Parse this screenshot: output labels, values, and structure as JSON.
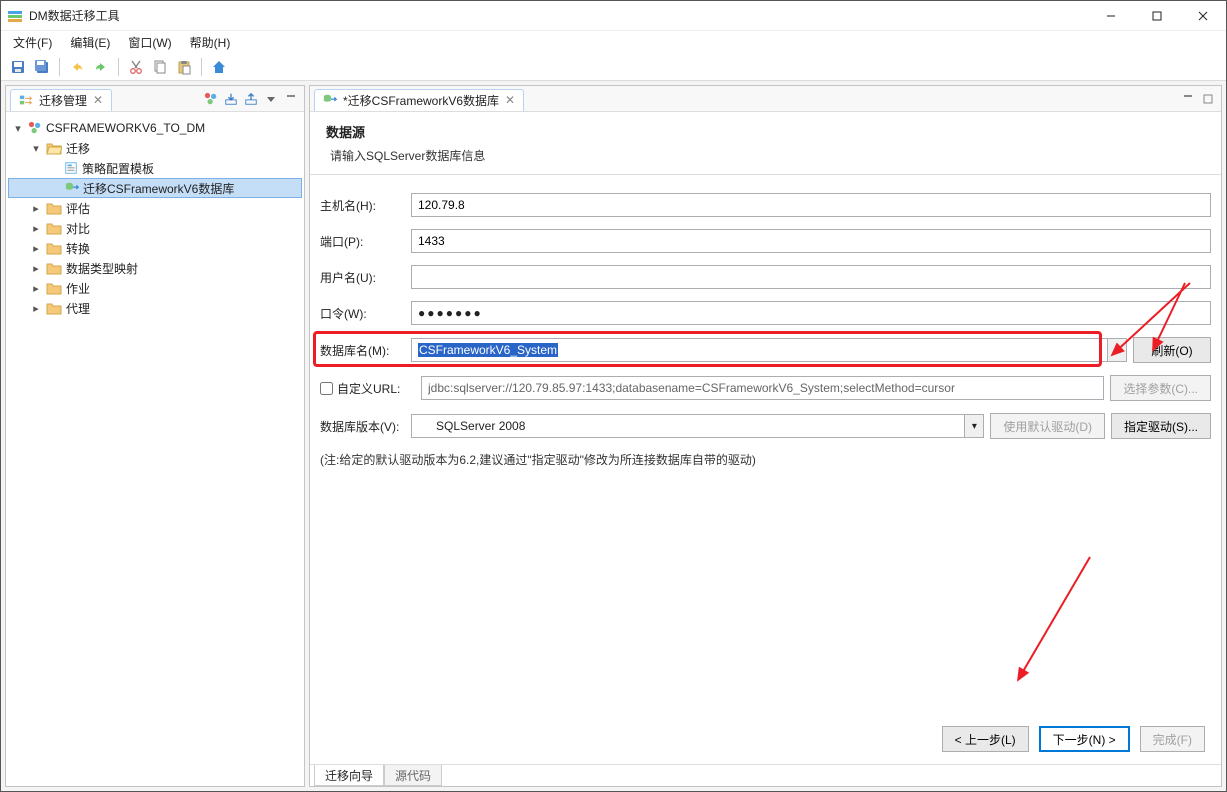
{
  "window": {
    "title": "DM数据迁移工具"
  },
  "menu": {
    "file": "文件(F)",
    "edit": "编辑(E)",
    "window": "窗口(W)",
    "help": "帮助(H)"
  },
  "leftPane": {
    "tabTitle": "迁移管理",
    "tree": {
      "root": "CSFRAMEWORKV6_TO_DM",
      "migrate": "迁移",
      "strategyTpl": "策略配置模板",
      "migrateDb": "迁移CSFrameworkV6数据库",
      "evaluate": "评估",
      "compare": "对比",
      "convert": "转换",
      "typeMap": "数据类型映射",
      "job": "作业",
      "proxy": "代理"
    }
  },
  "rightPane": {
    "tabTitle": "*迁移CSFrameworkV6数据库",
    "wizard": {
      "heading": "数据源",
      "sub": "请输入SQLServer数据库信息"
    },
    "form": {
      "hostLabel": "主机名(H):",
      "hostValue": "120.79.8",
      "portLabel": "端口(P):",
      "portValue": "1433",
      "userLabel": "用户名(U):",
      "userValue": "",
      "passLabel": "口令(W):",
      "passMask": "●●●●●●●",
      "dbLabel": "数据库名(M):",
      "dbValue": "CSFrameworkV6_System",
      "refreshBtn": "刷新(O)",
      "customUrlLabel": "自定义URL:",
      "urlValue": "jdbc:sqlserver://120.79.85.97:1433;databasename=CSFrameworkV6_System;selectMethod=cursor",
      "selectParamsBtn": "选择参数(C)...",
      "dbVersionLabel": "数据库版本(V):",
      "dbVersionValue": "SQLServer 2008",
      "useDefaultDriverBtn": "使用默认驱动(D)",
      "specifyDriverBtn": "指定驱动(S)...",
      "note": "(注:给定的默认驱动版本为6.2,建议通过\"指定驱动\"修改为所连接数据库自带的驱动)"
    },
    "footer": {
      "prev": "< 上一步(L)",
      "next": "下一步(N) >",
      "finish": "完成(F)"
    },
    "bottomTabs": {
      "wizard": "迁移向导",
      "source": "源代码"
    }
  }
}
